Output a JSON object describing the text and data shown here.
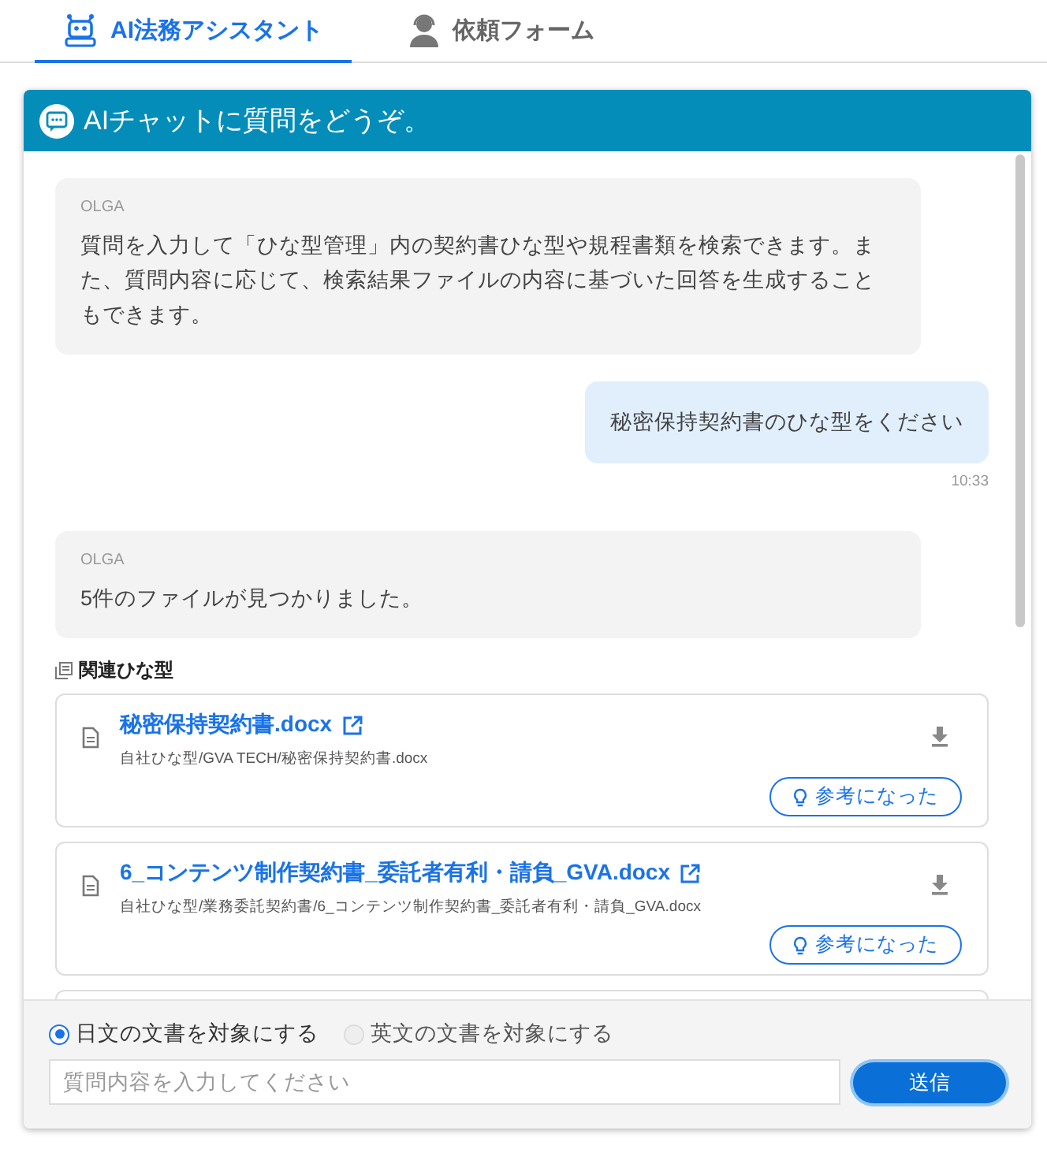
{
  "tabs": [
    {
      "label": "AI法務アシスタント",
      "selected": true,
      "kind": "robot"
    },
    {
      "label": "依頼フォーム",
      "selected": false,
      "kind": "person"
    }
  ],
  "chat": {
    "title": "AIチャットに質問をどうぞ。",
    "messages": [
      {
        "kind": "bot",
        "sender": "OLGA",
        "text": "質問を入力して「ひな型管理」内の契約書ひな型や規程書類を検索できます。また、質問内容に応じて、検索結果ファイルの内容に基づいた回答を生成することもできます。"
      },
      {
        "kind": "user",
        "text": "秘密保持契約書のひな型をください",
        "time": "10:33"
      },
      {
        "kind": "bot",
        "sender": "OLGA",
        "text": "5件のファイルが見つかりました。"
      }
    ],
    "related": {
      "title": "関連ひな型",
      "files": [
        {
          "name": "秘密保持契約書.docx",
          "path": "自社ひな型/GVA TECH/秘密保持契約書.docx",
          "feedback": "参考になった"
        },
        {
          "name": "6_コンテンツ制作契約書_委託者有利・請負_GVA.docx",
          "path": "自社ひな型/業務委託契約書/6_コンテンツ制作契約書_委託者有利・請負_GVA.docx",
          "feedback": "参考になった"
        }
      ]
    }
  },
  "composer": {
    "options": [
      {
        "label": "日文の文書を対象にする",
        "selected": true,
        "disabled": false
      },
      {
        "label": "英文の文書を対象にする",
        "selected": false,
        "disabled": true
      }
    ],
    "placeholder": "質問内容を入力してください",
    "send": "送信"
  }
}
